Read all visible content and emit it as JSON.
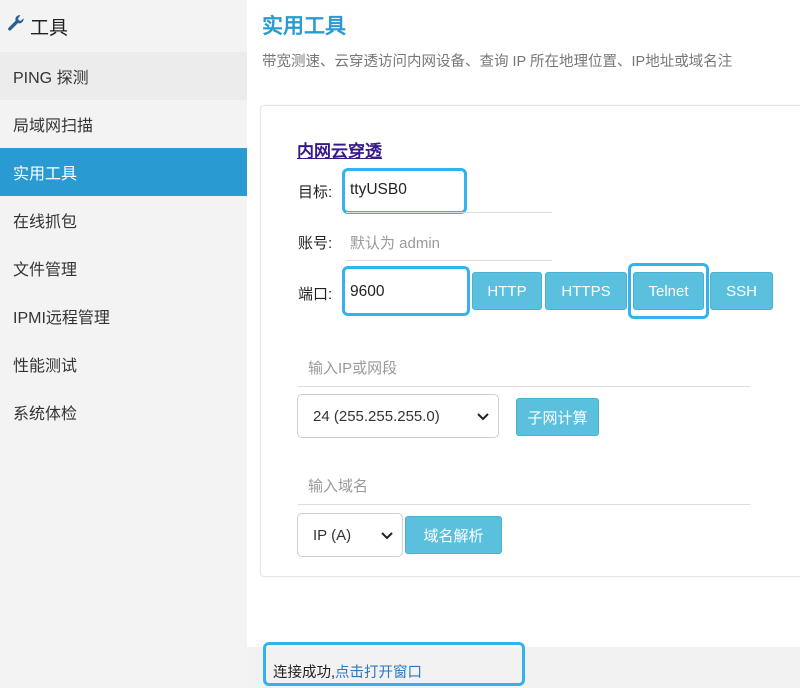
{
  "sidebar": {
    "title": "工具",
    "items": [
      {
        "label": "PING 探测"
      },
      {
        "label": "局域网扫描"
      },
      {
        "label": "实用工具"
      },
      {
        "label": "在线抓包"
      },
      {
        "label": "文件管理"
      },
      {
        "label": "IPMI远程管理"
      },
      {
        "label": "性能测试"
      },
      {
        "label": "系统体检"
      }
    ]
  },
  "main": {
    "title": "实用工具",
    "description": "带宽测速、云穿透访问内网设备、查询 IP 所在地理位置、IP地址或域名注"
  },
  "tunnel": {
    "title": "内网云穿透",
    "target_label": "目标:",
    "target_value": "ttyUSB0",
    "account_label": "账号:",
    "account_placeholder": "默认为 admin",
    "port_label": "端口:",
    "port_value": "9600",
    "protocols": [
      "HTTP",
      "HTTPS",
      "Telnet",
      "SSH"
    ]
  },
  "subnet": {
    "ip_placeholder": "输入IP或网段",
    "mask_selected": "24 (255.255.255.0)",
    "calc_button": "子网计算"
  },
  "dns": {
    "domain_placeholder": "输入域名",
    "record_selected": "IP (A)",
    "resolve_button": "域名解析"
  },
  "status": {
    "text": "连接成功,",
    "link": "点击打开窗口"
  },
  "colors": {
    "accent": "#2a9ad3",
    "button": "#5bc0de",
    "highlight": "#33b2ee",
    "section_title": "#3a1a8a"
  }
}
